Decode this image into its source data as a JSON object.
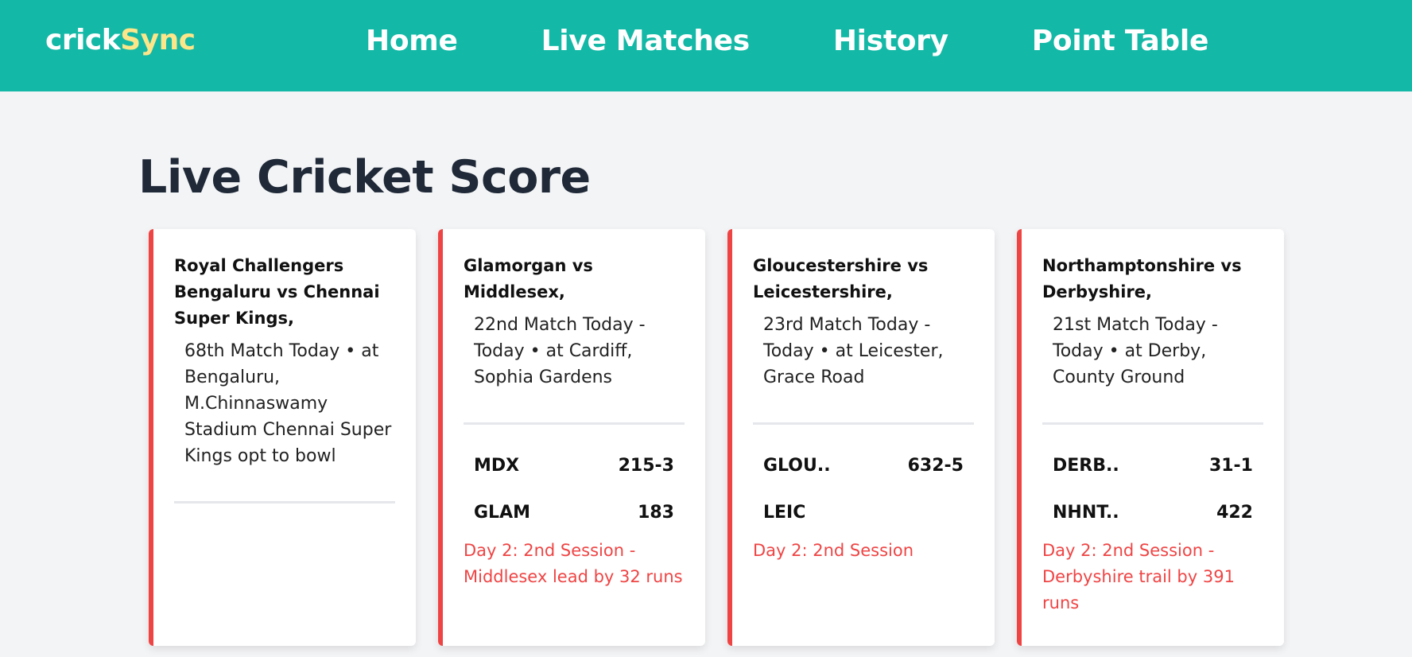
{
  "nav": {
    "brand_part1": "crick",
    "brand_part2": "Sync",
    "links": [
      "Home",
      "Live Matches",
      "History",
      "Point Table"
    ]
  },
  "page": {
    "title": "Live Cricket Score"
  },
  "colors": {
    "navbar": "#14b8a6",
    "brand_accent": "#fde68a",
    "card_border": "#ef4444",
    "status_text": "#ef4444"
  },
  "matches": [
    {
      "title": "Royal Challengers Bengaluru vs Chennai Super Kings,",
      "description": "68th Match Today • at Bengaluru, M.Chinnaswamy Stadium Chennai Super Kings opt to bowl",
      "teams": [],
      "status": ""
    },
    {
      "title": "Glamorgan vs Middlesex,",
      "description": "22nd Match Today - Today • at Cardiff, Sophia Gardens",
      "teams": [
        {
          "name": "MDX",
          "score": "215-3"
        },
        {
          "name": "GLAM",
          "score": "183"
        }
      ],
      "status": "Day 2: 2nd Session - Middlesex lead by 32 runs"
    },
    {
      "title": "Gloucestershire vs Leicestershire,",
      "description": "23rd Match Today - Today • at Leicester, Grace Road",
      "teams": [
        {
          "name": "GLOU..",
          "score": "632-5"
        },
        {
          "name": "LEIC",
          "score": ""
        }
      ],
      "status": "Day 2: 2nd Session"
    },
    {
      "title": "Northamptonshire vs Derbyshire,",
      "description": "21st Match Today - Today • at Derby, County Ground",
      "teams": [
        {
          "name": "DERB..",
          "score": "31-1"
        },
        {
          "name": "NHNT..",
          "score": "422"
        }
      ],
      "status": "Day 2: 2nd Session - Derbyshire trail by 391 runs"
    }
  ]
}
